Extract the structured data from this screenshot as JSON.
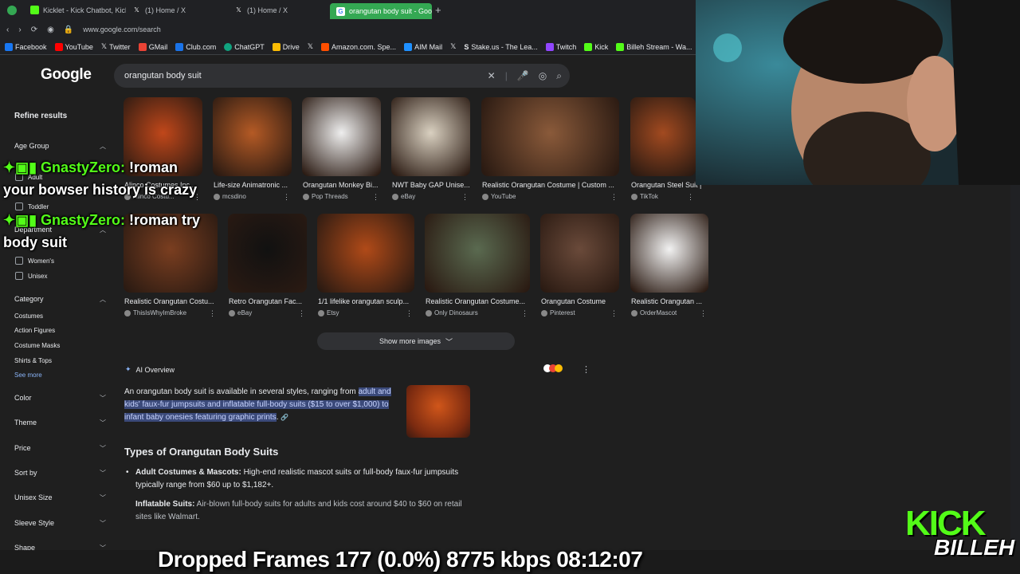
{
  "tabs": [
    {
      "label": "Kicklet - Kick Chatbot, Kick",
      "icon_color": "#53fc18"
    },
    {
      "label": "(1) Home / X",
      "icon_color": "#000000"
    },
    {
      "label": "(1) Home / X",
      "icon_color": "#000000"
    },
    {
      "label": "orangutan body suit - Goo",
      "icon_color": "#4285f4",
      "active": true
    }
  ],
  "address": {
    "url": "www.google.com/search"
  },
  "bookmarks": [
    {
      "label": "Facebook",
      "color": "#1877f2"
    },
    {
      "label": "YouTube",
      "color": "#ff0000"
    },
    {
      "label": "Twitter",
      "color": "#ffffff"
    },
    {
      "label": "GMail",
      "color": "#ea4335"
    },
    {
      "label": "Club.com",
      "color": "#1a73e8"
    },
    {
      "label": "ChatGPT",
      "color": "#10a37f"
    },
    {
      "label": "Drive",
      "color": "#fbbc04"
    },
    {
      "label": "",
      "color": "#ffffff"
    },
    {
      "label": "Amazon.com. Spe...",
      "color": "#ff9900"
    },
    {
      "label": "AIM Mail",
      "color": "#1e90ff"
    },
    {
      "label": "",
      "color": "#ffffff"
    },
    {
      "label": "Stake.us - The Lea...",
      "color": "#0f212e"
    },
    {
      "label": "Twitch",
      "color": "#9146ff"
    },
    {
      "label": "Kick",
      "color": "#53fc18"
    },
    {
      "label": "Billeh Stream - Wa...",
      "color": "#53fc18"
    }
  ],
  "google": {
    "logo": "Google",
    "query": "orangutan body suit"
  },
  "sidebar": {
    "title": "Refine results",
    "age_group": "Age Group",
    "age_items": [
      "Adult",
      "Toddler"
    ],
    "department": "Department",
    "dept_items": [
      "Women's",
      "Unisex"
    ],
    "category": "Category",
    "category_items": [
      "Costumes",
      "Action Figures",
      "Costume Masks",
      "Shirts & Tops"
    ],
    "see_more": "See more",
    "filters": [
      "Color",
      "Theme",
      "Price",
      "Sort by",
      "Unisex Size",
      "Sleeve Style",
      "Shape"
    ]
  },
  "images_row1": [
    {
      "caption": "Alinco Costumes Inc...",
      "source": "Alinco Costu...",
      "color": "#c0471a"
    },
    {
      "caption": "Life-size Animatronic ...",
      "source": "mcsdino",
      "color": "#b45a25"
    },
    {
      "caption": "Orangutan Monkey Bi...",
      "source": "Pop Threads",
      "color": "#eeeeee"
    },
    {
      "caption": "NWT Baby GAP Unise...",
      "source": "eBay",
      "color": "#d9d0c0"
    },
    {
      "caption": "Realistic Orangutan Costume | Custom ...",
      "source": "YouTube",
      "color": "#8a5a3a"
    },
    {
      "caption": "Orangutan Steel Suit |...",
      "source": "TikTok",
      "color": "#a24a20"
    }
  ],
  "images_row2": [
    {
      "caption": "Realistic Orangutan Costu...",
      "source": "ThisIsWhyImBroke",
      "color": "#7a3e20"
    },
    {
      "caption": "Retro Orangutan Fac...",
      "source": "eBay",
      "color": "#111111"
    },
    {
      "caption": "1/1 lifelike orangutan sculp...",
      "source": "Etsy",
      "color": "#b04a18"
    },
    {
      "caption": "Realistic Orangutan Costume...",
      "source": "Only Dinosaurs",
      "color": "#5a6a50"
    },
    {
      "caption": "Orangutan Costume",
      "source": "Pinterest",
      "color": "#6a4a3a"
    },
    {
      "caption": "Realistic Orangutan ...",
      "source": "OrderMascot",
      "color": "#f2f2f2"
    }
  ],
  "show_more": "Show more images",
  "ai": {
    "label": "AI Overview",
    "text_plain": "An orangutan body suit is available in several styles, ranging from ",
    "text_hl": "adult and kids' faux-fur jumpsuits and inflatable full-body suits ($15 to over $1,000) to infant baby onesies featuring graphic prints",
    "text_end": "."
  },
  "types": {
    "title": "Types of Orangutan Body Suits",
    "b1_title": "Adult Costumes & Mascots:",
    "b1_text": " High-end realistic mascot suits or full-body faux-fur jumpsuits typically range from $60 up to $1,182+.",
    "b2_title": "Inflatable Suits:",
    "b2_text": " Air-blown full-body suits for adults and kids cost around $40 to $60 on retail sites like Walmart."
  },
  "chat": [
    {
      "user": "GnastyZero:",
      "line1": " !roman",
      "line2": "your bowser history is crazy"
    },
    {
      "user": "GnastyZero:",
      "line1": " !roman try",
      "line2": "body suit"
    }
  ],
  "stream_stats": "Dropped Frames 177 (0.0%)   8775 kbps   08:12:07",
  "kick_logo": {
    "word": "KICK",
    "name": "BILLEH"
  },
  "colors": {
    "kick_green": "#53fc18",
    "google_bg": "#1f1f1f",
    "highlight": "#3b4a7a"
  }
}
